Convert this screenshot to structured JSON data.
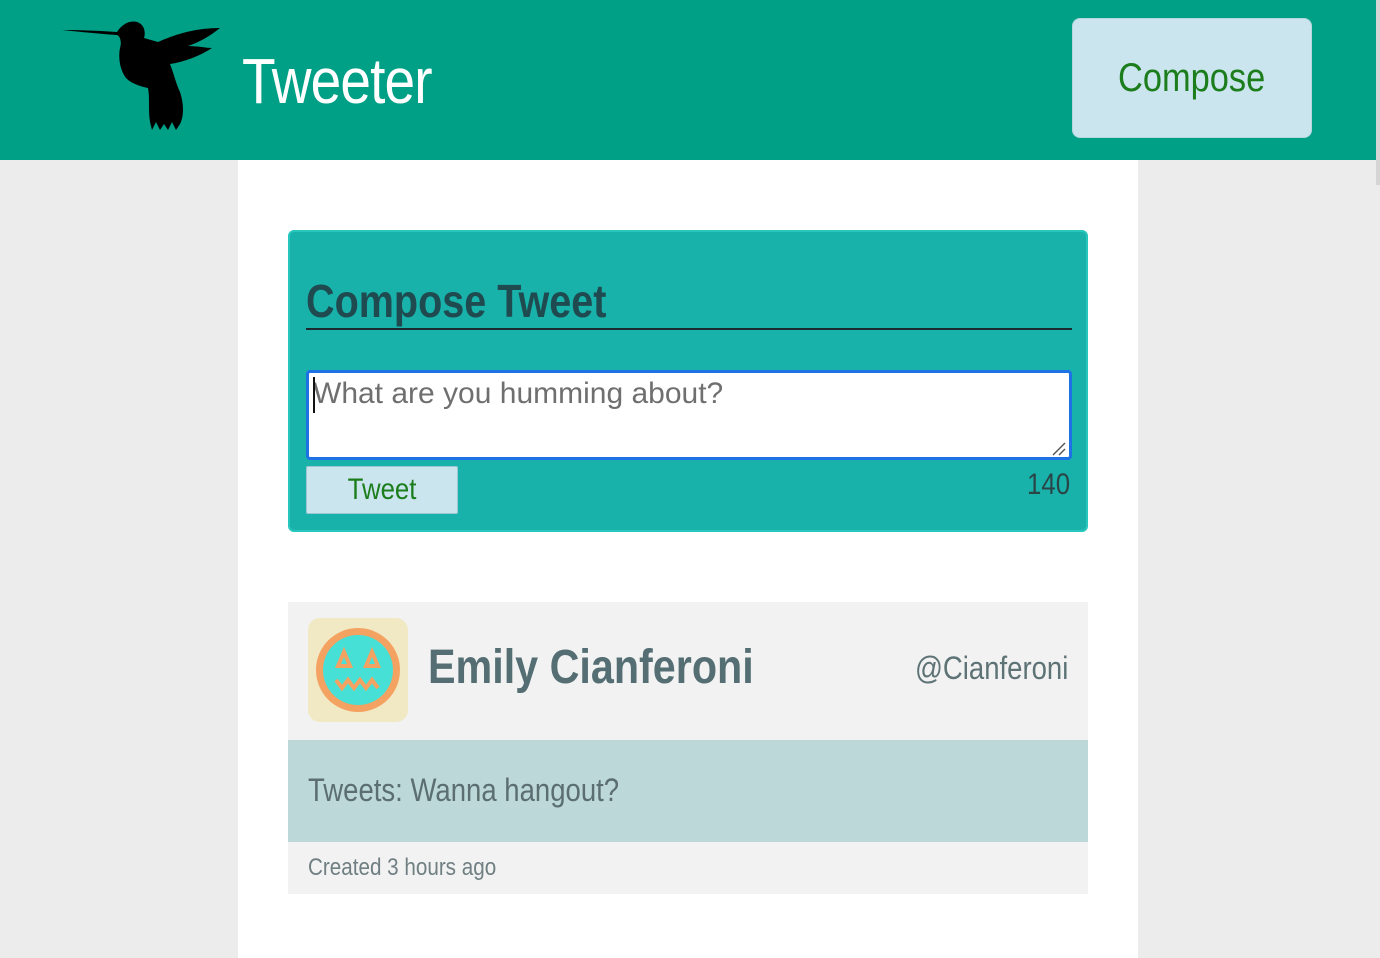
{
  "header": {
    "brand": "Tweeter",
    "logo_icon": "hummingbird-icon",
    "compose_label": "Compose",
    "background": "#00a087"
  },
  "compose": {
    "title": "Compose Tweet",
    "placeholder": "What are you humming about?",
    "value": "",
    "submit_label": "Tweet",
    "char_counter": "140"
  },
  "tweets": [
    {
      "avatar_icon": "pumpkin-face-avatar-icon",
      "name": "Emily Cianferoni",
      "handle": "@Cianferoni",
      "text": "Tweets: Wanna hangout?",
      "created": "Created 3 hours ago"
    }
  ],
  "colors": {
    "accent": "#00a087",
    "compose_panel": "#19b2ab",
    "button_bg": "#cbe5ee",
    "button_text": "#1c7d1c",
    "tweet_body": "#bdd8d8"
  }
}
